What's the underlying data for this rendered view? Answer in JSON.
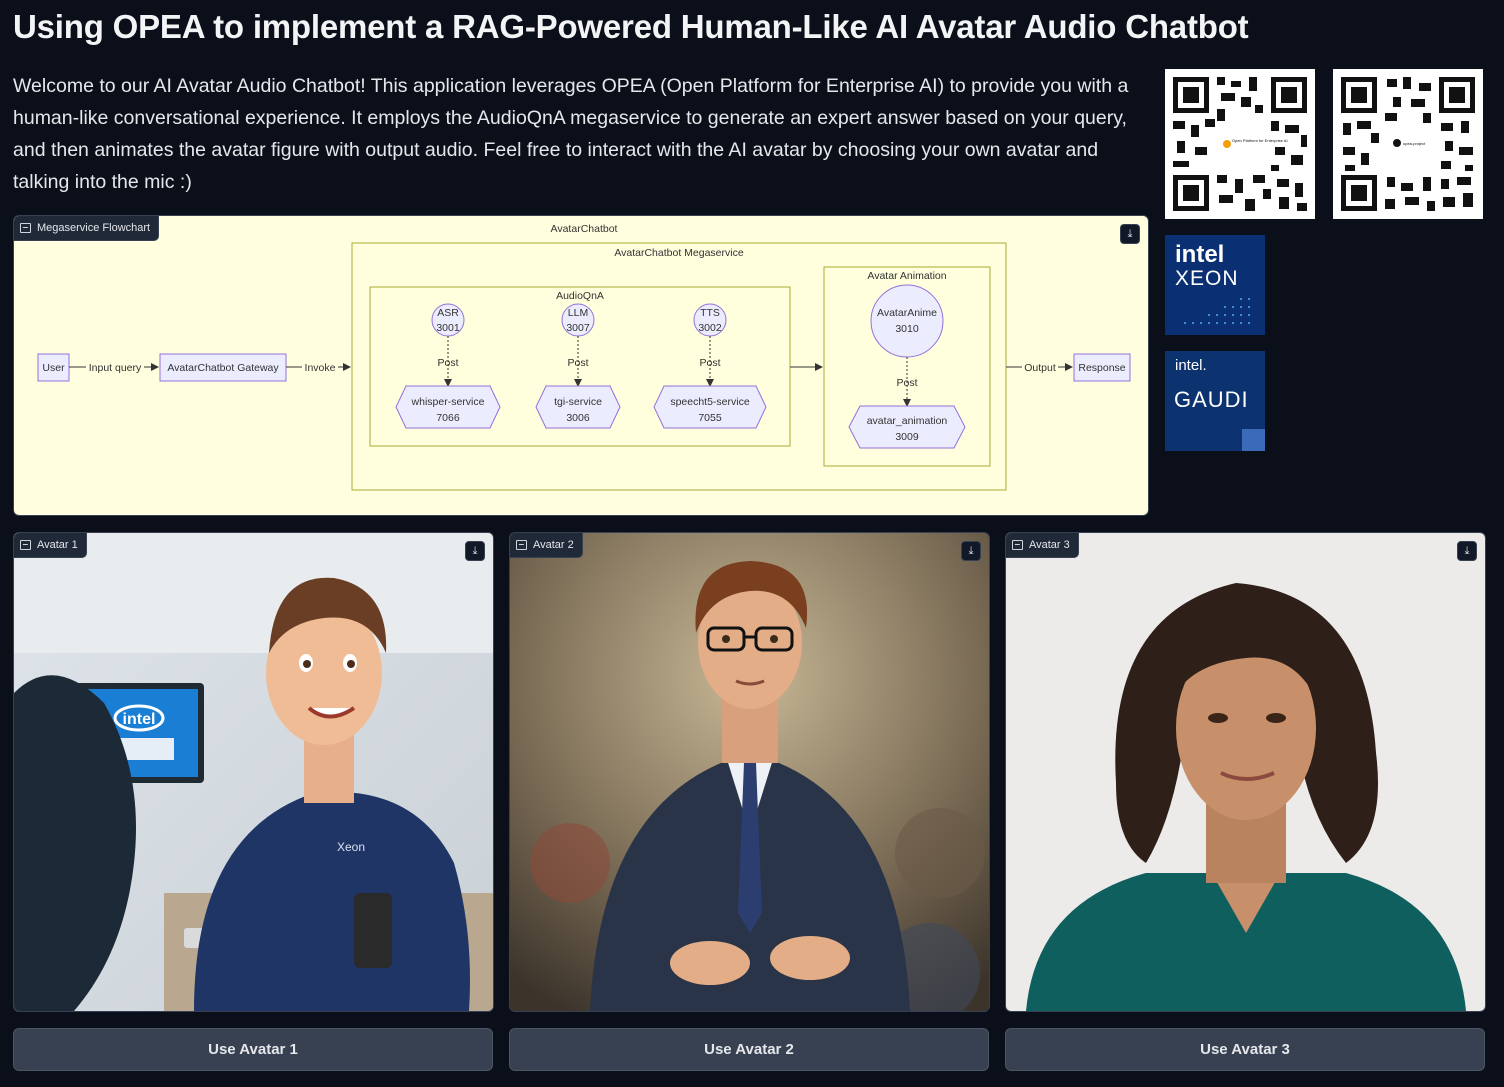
{
  "page": {
    "title": "Using OPEA to implement a RAG-Powered Human-Like AI Avatar Audio Chatbot",
    "description": "Welcome to our AI Avatar Audio Chatbot! This application leverages OPEA (Open Platform for Enterprise AI) to provide you with a human-like conversational experience. It employs the AudioQnA megaservice to generate an expert answer based on your query, and then animates the avatar figure with output audio. Feel free to interact with the AI avatar by choosing your own avatar and talking into the mic :)"
  },
  "flowchart": {
    "label": "Megaservice Flowchart",
    "outer_title": "AvatarChatbot",
    "megaservice_title": "AvatarChatbot Megaservice",
    "audioqna_title": "AudioQnA",
    "animation_title": "Avatar Animation",
    "user": "User",
    "input_query": "Input query",
    "gateway": "AvatarChatbot Gateway",
    "invoke": "Invoke",
    "output": "Output",
    "response": "Response",
    "post": "Post",
    "asr": "ASR",
    "asr_port": "3001",
    "llm": "LLM",
    "llm_port": "3007",
    "tts": "TTS",
    "tts_port": "3002",
    "whisper": "whisper-service",
    "whisper_port": "7066",
    "tgi": "tgi-service",
    "tgi_port": "3006",
    "speecht5": "speecht5-service",
    "speecht5_port": "7055",
    "avataranime": "AvatarAnime",
    "avataranime_port": "3010",
    "avatar_animation": "avatar_animation",
    "avatar_animation_port": "3009"
  },
  "sidebar_logos": {
    "xeon_brand": "intel",
    "xeon_name": "XEON",
    "gaudi_brand": "intel.",
    "gaudi_name": "GAUDI",
    "qr1_caption": "Open Platform for Enterprise AI",
    "qr2_caption": "opea-project"
  },
  "avatars": [
    {
      "label": "Avatar 1",
      "button": "Use Avatar 1",
      "shirt_text": "Xeon",
      "screen_text": "intel"
    },
    {
      "label": "Avatar 2",
      "button": "Use Avatar 2"
    },
    {
      "label": "Avatar 3",
      "button": "Use Avatar 3"
    }
  ],
  "colors": {
    "background": "#0b0f19",
    "button": "#374151",
    "flowchart_bg": "#ffffe0",
    "flowchart_node": "#ececff",
    "flowchart_border": "#9370db"
  }
}
